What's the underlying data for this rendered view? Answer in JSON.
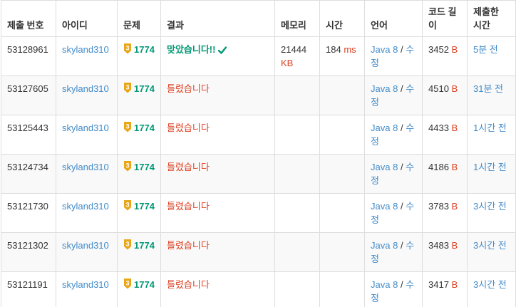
{
  "columns": {
    "submission_id": "제출 번호",
    "user_id": "아이디",
    "problem": "문제",
    "result": "결과",
    "memory": "메모리",
    "time": "시간",
    "language": "언어",
    "code_length": "코드 길이",
    "submitted_at": "제출한 시간"
  },
  "colors": {
    "link": "#428bca",
    "accepted": "#009874",
    "wrong": "#dd4124",
    "tier_badge": "#e8a719"
  },
  "rows": [
    {
      "submission_id": "53128961",
      "user_id": "skyland310",
      "tier_number": "3",
      "problem_number": "1774",
      "result": "맞았습니다!!",
      "accepted": true,
      "memory_value": "21444",
      "memory_unit": "KB",
      "time_value": "184",
      "time_unit": "ms",
      "language": "Java 8",
      "edit": "수정",
      "code_length": "3452",
      "code_unit": "B",
      "submitted_at": "5분 전"
    },
    {
      "submission_id": "53127605",
      "user_id": "skyland310",
      "tier_number": "3",
      "problem_number": "1774",
      "result": "틀렸습니다",
      "accepted": false,
      "memory_value": "",
      "memory_unit": "",
      "time_value": "",
      "time_unit": "",
      "language": "Java 8",
      "edit": "수정",
      "code_length": "4510",
      "code_unit": "B",
      "submitted_at": "31분 전"
    },
    {
      "submission_id": "53125443",
      "user_id": "skyland310",
      "tier_number": "3",
      "problem_number": "1774",
      "result": "틀렸습니다",
      "accepted": false,
      "memory_value": "",
      "memory_unit": "",
      "time_value": "",
      "time_unit": "",
      "language": "Java 8",
      "edit": "수정",
      "code_length": "4433",
      "code_unit": "B",
      "submitted_at": "1시간 전"
    },
    {
      "submission_id": "53124734",
      "user_id": "skyland310",
      "tier_number": "3",
      "problem_number": "1774",
      "result": "틀렸습니다",
      "accepted": false,
      "memory_value": "",
      "memory_unit": "",
      "time_value": "",
      "time_unit": "",
      "language": "Java 8",
      "edit": "수정",
      "code_length": "4186",
      "code_unit": "B",
      "submitted_at": "1시간 전"
    },
    {
      "submission_id": "53121730",
      "user_id": "skyland310",
      "tier_number": "3",
      "problem_number": "1774",
      "result": "틀렸습니다",
      "accepted": false,
      "memory_value": "",
      "memory_unit": "",
      "time_value": "",
      "time_unit": "",
      "language": "Java 8",
      "edit": "수정",
      "code_length": "3783",
      "code_unit": "B",
      "submitted_at": "3시간 전"
    },
    {
      "submission_id": "53121302",
      "user_id": "skyland310",
      "tier_number": "3",
      "problem_number": "1774",
      "result": "틀렸습니다",
      "accepted": false,
      "memory_value": "",
      "memory_unit": "",
      "time_value": "",
      "time_unit": "",
      "language": "Java 8",
      "edit": "수정",
      "code_length": "3483",
      "code_unit": "B",
      "submitted_at": "3시간 전"
    },
    {
      "submission_id": "53121191",
      "user_id": "skyland310",
      "tier_number": "3",
      "problem_number": "1774",
      "result": "틀렸습니다",
      "accepted": false,
      "memory_value": "",
      "memory_unit": "",
      "time_value": "",
      "time_unit": "",
      "language": "Java 8",
      "edit": "수정",
      "code_length": "3417",
      "code_unit": "B",
      "submitted_at": "3시간 전"
    }
  ]
}
